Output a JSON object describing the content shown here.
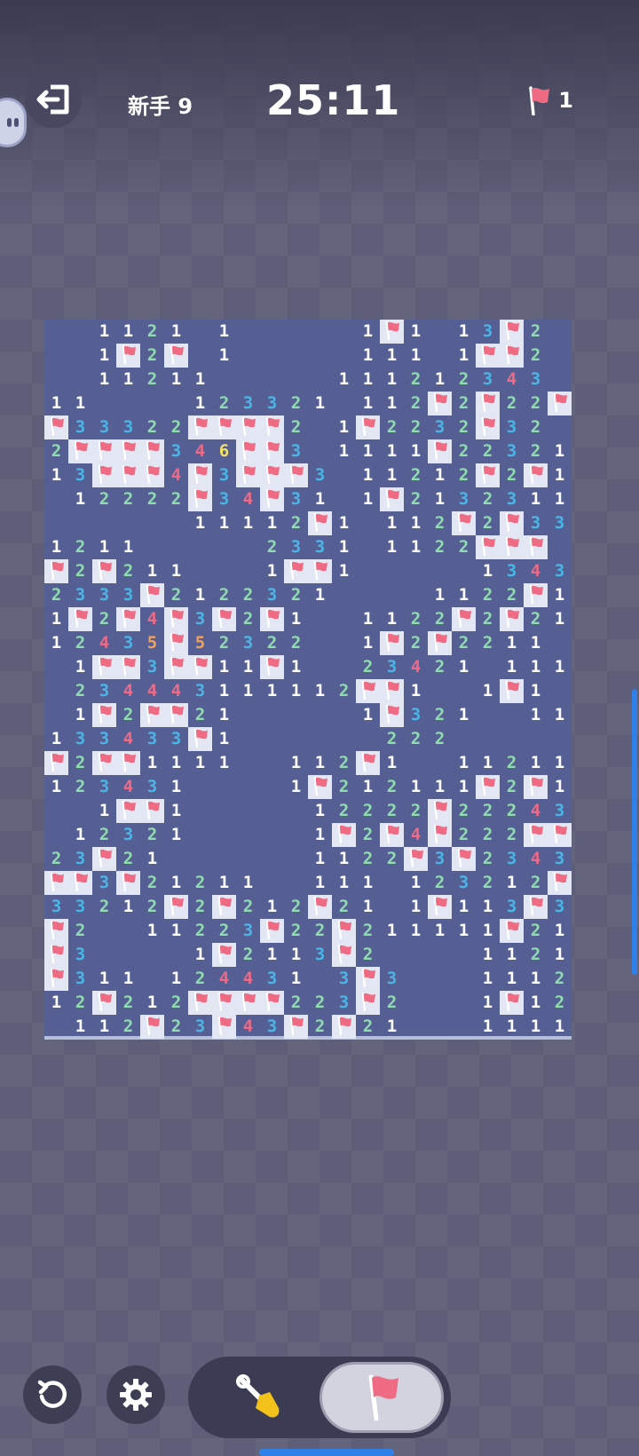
{
  "header": {
    "level": "新手 9",
    "timer": "25:11",
    "flags_left": "1"
  },
  "icons": {
    "exit": "exit-icon",
    "chat": "chat-bubble-icon",
    "flag": "flag-icon",
    "restart": "restart-icon",
    "settings": "gear-icon",
    "dig": "shovel-icon"
  },
  "colors": {
    "board": "#555f94",
    "revealed": "#555f94",
    "flag_tile": "#e3e6f3",
    "flag": "#ef6b84",
    "n1": "#ffffff",
    "n2": "#8fdcae",
    "n3": "#49b6e7",
    "n4": "#ee6a86",
    "n5": "#f2a15a",
    "n6": "#f2e267",
    "active_mode": "flag"
  },
  "board": {
    "cols": 22,
    "rows": 30,
    "legend": "'.' empty revealed, 'F' flag, '#' covered, digits = mine count",
    "rows_data": [
      "..1121.1.....1F1.13F2.",
      "..1F2F.1.....111.1FF2.",
      "..11211.....11121234 3",
      "11....12332 1.112F2F22FF",
      "F33322FFFF2.1F2232F32.",
      "2FFFF34 6FF3.11 11F22321",
      "13FF F4F3FFF3.1121 2F2F1",
      ".12222F34F31.1F21 3231 1",
      "......11112F1.112F2F332",
      "1211.....2331.1122 FFF",
      "F2F211...1FF1.....13 43",
      "2333F2122 321....112 2F1",
      "1F2F4F3F2F1..1122F2F21",
      "1243 5F52322..1F2F2211.",
      ".1FF3FF11F1..234 21.111",
      ".234443 1111 12FF1..1F1",
      ".1F2FF21.....1F321..111",
      "13343 3F1......222.....",
      "F2FF1111..112F1..11211",
      "12343 1....1F21211 1F2F1",
      "..1FF1.....122 22F2224 32",
      ".12321.....1F2F4F222FF1",
      "23F21......1122F3F2 343",
      "FF3F2121 1..111.123 212FF",
      "33212F2F212F21.1F11 3F3",
      "F2..1122 3F22F2111 11F21",
      "F3....1F2113F2....1121",
      "F311.12443 1.3F3...1112F",
      "12F212FFFF223F2...1F12#",
      ".112F23F43F2F21...1111#"
    ]
  }
}
